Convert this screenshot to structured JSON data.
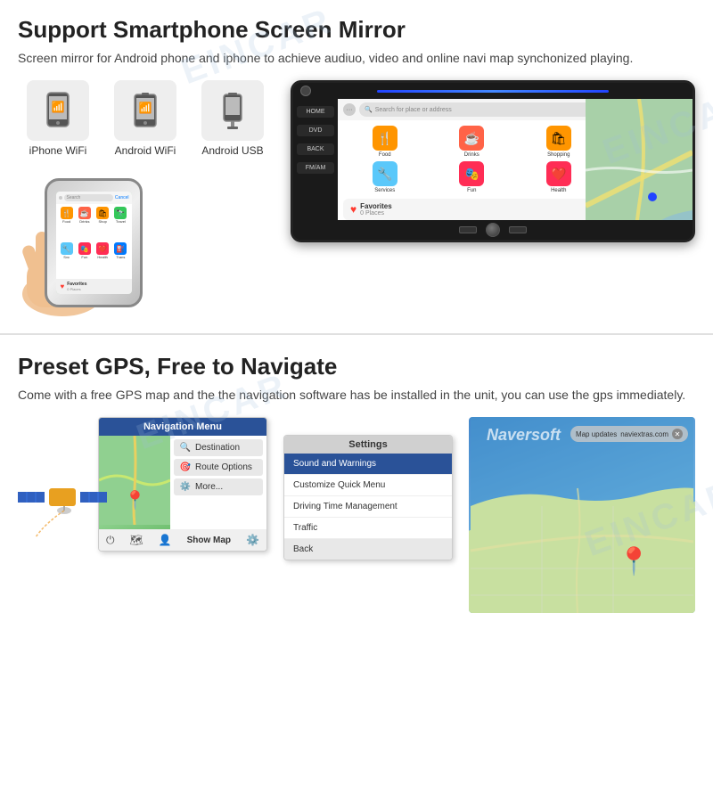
{
  "section1": {
    "title": "Support Smartphone Screen Mirror",
    "description": "Screen mirror for Android phone and iphone to achieve audiuo, video and online navi map synchonized playing.",
    "icons": [
      {
        "id": "iphone-wifi",
        "label": "iPhone WiFi",
        "icon": "📱",
        "color": "#e0e0e0"
      },
      {
        "id": "android-wifi",
        "label": "Android WiFi",
        "icon": "📲",
        "color": "#e0e0e0"
      },
      {
        "id": "android-usb",
        "label": "Android USB",
        "icon": "🔌",
        "color": "#e0e0e0"
      }
    ],
    "carplay": {
      "search_placeholder": "Search for place or address",
      "cancel_label": "Cancel",
      "icons": [
        {
          "label": "Food",
          "icon": "🍴",
          "color": "#ff9500"
        },
        {
          "label": "Drinks",
          "icon": "☕",
          "color": "#ff6347"
        },
        {
          "label": "Shopping",
          "icon": "🛍",
          "color": "#ff9500"
        },
        {
          "label": "Travel",
          "icon": "🔭",
          "color": "#34c759"
        },
        {
          "label": "Services",
          "icon": "🔧",
          "color": "#5ac8fa"
        },
        {
          "label": "Fun",
          "icon": "🎭",
          "color": "#ff2d55"
        },
        {
          "label": "Health",
          "icon": "❤️",
          "color": "#ff2d55"
        },
        {
          "label": "Transport",
          "icon": "⛽",
          "color": "#007aff"
        }
      ],
      "favorites_label": "Favorites",
      "favorites_sub": "0 Places"
    },
    "car_sidebar": [
      "HOME",
      "DVD",
      "BACK",
      "FM/AM"
    ]
  },
  "section2": {
    "title": "Preset GPS, Free to Navigate",
    "description": "Come with a free GPS map and the the navigation software has be installed in the unit, you can use the gps immediately.",
    "nav_menu": {
      "header": "Navigation Menu",
      "items": [
        {
          "icon": "🔍",
          "label": "Destination"
        },
        {
          "icon": "🎯",
          "label": "Route Options"
        },
        {
          "icon": "⚙️",
          "label": "More..."
        }
      ],
      "show_map_label": "Show Map"
    },
    "settings": {
      "header": "Settings",
      "items": [
        {
          "label": "Sound and Warnings",
          "active": true
        },
        {
          "label": "Customize Quick Menu",
          "active": false
        },
        {
          "label": "Driving Time Management",
          "active": false
        },
        {
          "label": "Traffic",
          "active": false
        }
      ],
      "back_label": "Back"
    },
    "gps_brand": "Naversoft",
    "map_update": {
      "text": "Map updates",
      "link": "naviextras.com"
    }
  },
  "watermark": "EINCAR"
}
